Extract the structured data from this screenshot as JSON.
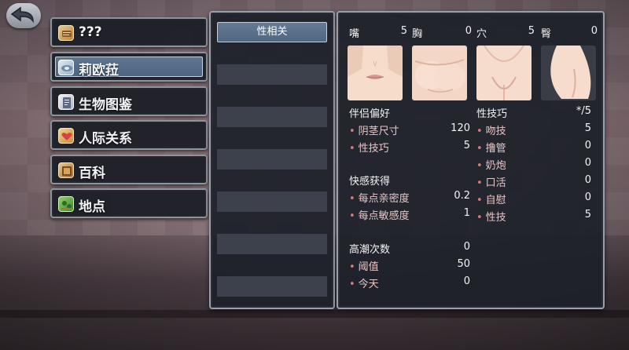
{
  "menu": [
    {
      "label": "???",
      "icon": "scroll-icon"
    },
    {
      "label": "莉欧菈",
      "icon": "card-icon"
    },
    {
      "label": "生物图鉴",
      "icon": "book-icon"
    },
    {
      "label": "人际关系",
      "icon": "heart-letter-icon"
    },
    {
      "label": "百科",
      "icon": "encyclopedia-icon"
    },
    {
      "label": "地点",
      "icon": "map-icon"
    }
  ],
  "active_menu": "莉欧菈",
  "middle": {
    "tab_label": "性相关"
  },
  "body_parts": [
    {
      "label": "嘴",
      "value": "5"
    },
    {
      "label": "胸",
      "value": "0"
    },
    {
      "label": "穴",
      "value": "5"
    },
    {
      "label": "臀",
      "value": "0"
    }
  ],
  "partner_prefs": {
    "heading": "伴侣偏好",
    "rows": [
      {
        "label": "阴茎尺寸",
        "value": "120"
      },
      {
        "label": "性技巧",
        "value": "5"
      }
    ]
  },
  "pleasure": {
    "heading": "快感获得",
    "rows": [
      {
        "label": "每点亲密度",
        "value": "0.2"
      },
      {
        "label": "每点敏感度",
        "value": "1"
      }
    ]
  },
  "climax": {
    "heading": "高潮次数",
    "value": "0",
    "rows": [
      {
        "label": "阈值",
        "value": "50"
      },
      {
        "label": "今天",
        "value": "0"
      }
    ]
  },
  "skills": {
    "heading": "性技巧",
    "max": "*/5",
    "rows": [
      {
        "label": "吻技",
        "value": "5"
      },
      {
        "label": "撸管",
        "value": "0"
      },
      {
        "label": "奶炮",
        "value": "0"
      },
      {
        "label": "口活",
        "value": "0"
      },
      {
        "label": "自慰",
        "value": "0"
      },
      {
        "label": "性技",
        "value": "5"
      }
    ]
  },
  "colors": {
    "accent": "#5f7691",
    "bullet": "#d97b7b",
    "panel_bg": "#1e2129",
    "border": "#9aa0aa"
  }
}
